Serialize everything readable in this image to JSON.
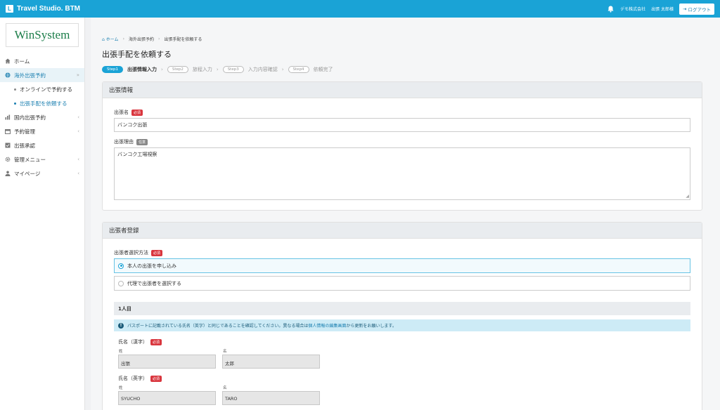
{
  "topbar": {
    "brand": "Travel Studio. BTM",
    "brand_logo_letter": "L",
    "company": "デモ株式会社",
    "user": "出張 太郎様",
    "logout_label": "ログアウト",
    "accent_color": "#1aa3d6"
  },
  "sidebar": {
    "logo_text": "WinSystem",
    "items": [
      {
        "label": "ホーム",
        "icon": "home-icon"
      },
      {
        "label": "海外出張予約",
        "icon": "globe-icon",
        "expanded": true
      },
      {
        "label": "オンラインで予約する"
      },
      {
        "label": "出張手配を依頼する",
        "active": true
      },
      {
        "label": "国内出張予約",
        "icon": "chart-icon"
      },
      {
        "label": "予約管理",
        "icon": "calendar-icon"
      },
      {
        "label": "出張承認",
        "icon": "check-icon"
      },
      {
        "label": "管理メニュー",
        "icon": "gear-icon"
      },
      {
        "label": "マイページ",
        "icon": "user-icon"
      }
    ]
  },
  "breadcrumb": {
    "home": "ホーム",
    "level1": "海外出張予約",
    "level2": "出張手配を依頼する"
  },
  "page_title": "出張手配を依頼する",
  "steps": [
    {
      "pill": "Step1",
      "label": "出張情報入力",
      "active": true
    },
    {
      "pill": "Step2",
      "label": "旅程入力"
    },
    {
      "pill": "Step3",
      "label": "入力内容確認"
    },
    {
      "pill": "Step4",
      "label": "依頼完了"
    }
  ],
  "trip_info": {
    "header": "出張情報",
    "name_label": "出張名",
    "required_badge": "必須",
    "optional_badge": "任意",
    "name_value": "バンコク出張",
    "reason_label": "出張理由",
    "reason_value": "バンコク工場視察"
  },
  "traveler": {
    "header": "出張者登録",
    "method_label": "出張者選択方法",
    "options": [
      {
        "label": "本人の出張を申し込み",
        "selected": true
      },
      {
        "label": "代理で出張者を選択する",
        "selected": false
      }
    ],
    "person_heading": "1人目",
    "alert_text_before": "パスポートに記載されている氏名（英字）と同じであることを確認してください。異なる場合は",
    "alert_link": "個人情報の編集画面",
    "alert_text_after": "から更新をお願いします。",
    "kanji_label": "氏名（漢字）",
    "english_label": "氏名（英字）",
    "last_label": "姓",
    "first_label": "名",
    "kanji_last": "出張",
    "kanji_first": "太郎",
    "english_last": "SYUCHO",
    "english_first": "TARO"
  }
}
